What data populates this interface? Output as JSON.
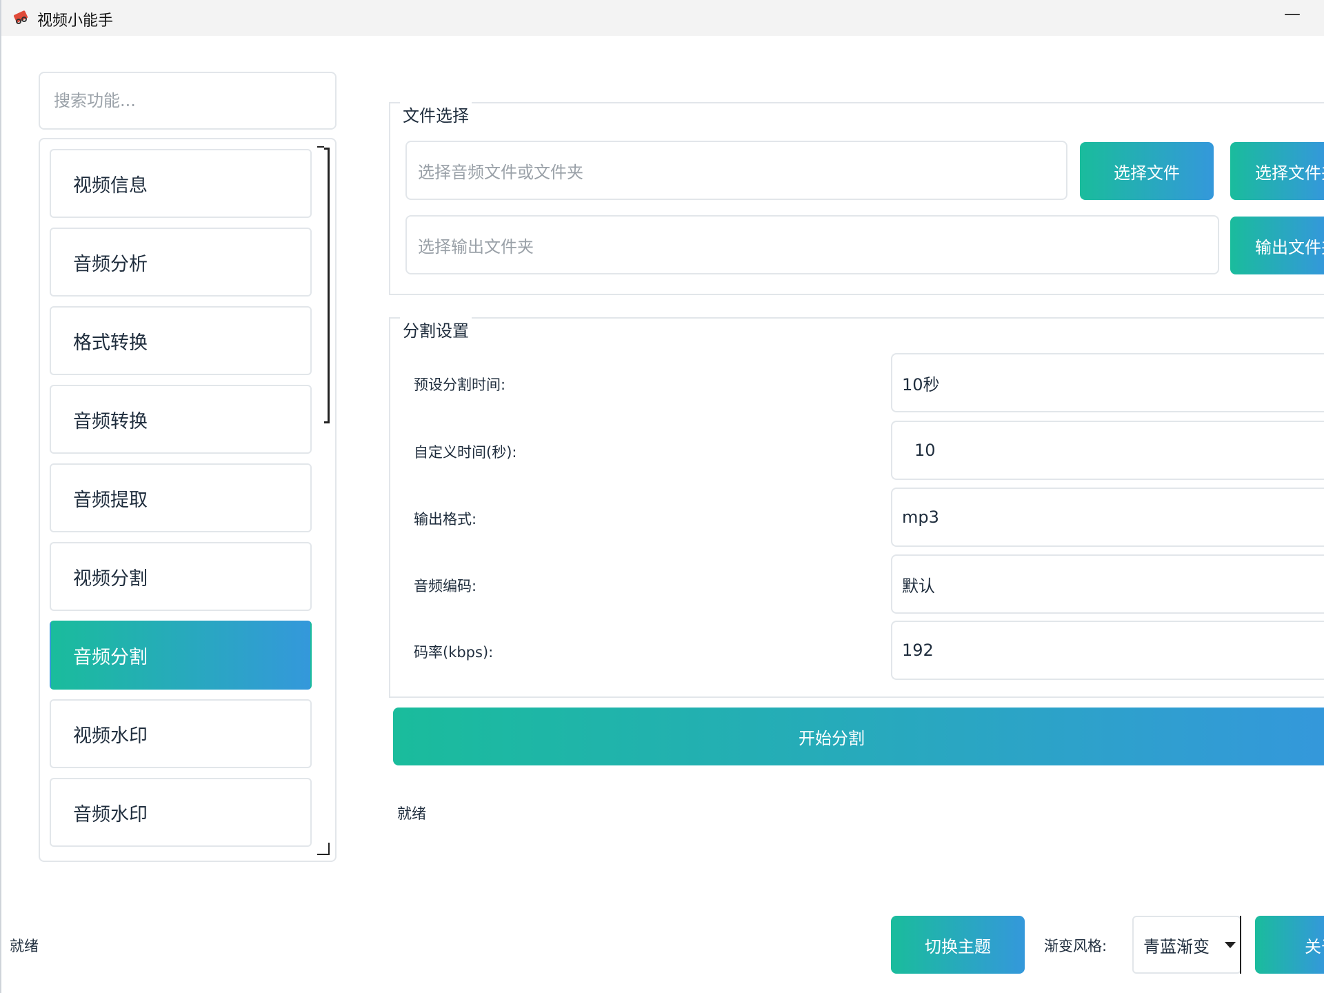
{
  "window": {
    "title": "视频小能手",
    "minimize": "—"
  },
  "sidebar": {
    "search_placeholder": "搜索功能...",
    "items": [
      {
        "label": "视频信息"
      },
      {
        "label": "音频分析"
      },
      {
        "label": "格式转换"
      },
      {
        "label": "音频转换"
      },
      {
        "label": "音频提取"
      },
      {
        "label": "视频分割"
      },
      {
        "label": "音频分割",
        "active": true
      },
      {
        "label": "视频水印"
      },
      {
        "label": "音频水印"
      }
    ]
  },
  "file_group": {
    "title": "文件选择",
    "input_placeholder": "选择音频文件或文件夹",
    "select_file_label": "选择文件",
    "select_folder_label": "选择文件夹",
    "output_placeholder": "选择输出文件夹",
    "output_button_label": "输出文件夹"
  },
  "split_group": {
    "title": "分割设置",
    "rows": [
      {
        "label": "预设分割时间:",
        "value": "10秒"
      },
      {
        "label": "自定义时间(秒):",
        "value": "10"
      },
      {
        "label": "输出格式:",
        "value": "mp3"
      },
      {
        "label": "音频编码:",
        "value": "默认"
      },
      {
        "label": "码率(kbps):",
        "value": "192"
      }
    ]
  },
  "start_button_label": "开始分割",
  "status_text": "就绪",
  "bottom_bar": {
    "status": "就绪",
    "theme_button_label": "切换主题",
    "gradient_label": "渐变风格:",
    "gradient_value": "青蓝渐变",
    "about_label": "关于"
  },
  "colors": {
    "gradient_start": "#1abc9c",
    "gradient_end": "#3498db",
    "border": "#e2e6ea"
  }
}
